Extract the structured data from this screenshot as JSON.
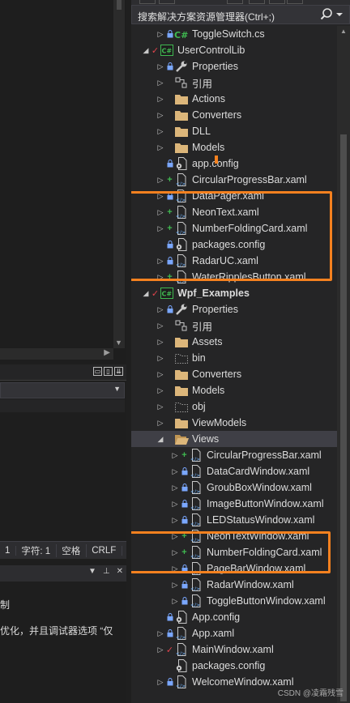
{
  "search": {
    "placeholder": "搜索解决方案资源管理器(Ctrl+;)"
  },
  "status_bar": {
    "line_col": "1",
    "char": "字符: 1",
    "spaces": "空格",
    "eol": "CRLF"
  },
  "output_text": {
    "line1": "制",
    "line2": "优化，并且调试器选项 “仅"
  },
  "tree": [
    {
      "label": "ToggleSwitch.cs",
      "depth": 1,
      "exp": "closed",
      "status": "lock",
      "icon": "csharp-file-icon"
    },
    {
      "label": "UserControlLib",
      "depth": 0,
      "exp": "open",
      "status": "check",
      "icon": "csharp-project-icon"
    },
    {
      "label": "Properties",
      "depth": 1,
      "exp": "closed",
      "status": "lock",
      "icon": "wrench-icon"
    },
    {
      "label": "引用",
      "depth": 1,
      "exp": "closed",
      "status": "",
      "icon": "references-icon"
    },
    {
      "label": "Actions",
      "depth": 1,
      "exp": "closed",
      "status": "",
      "icon": "folder-icon"
    },
    {
      "label": "Converters",
      "depth": 1,
      "exp": "closed",
      "status": "",
      "icon": "folder-icon"
    },
    {
      "label": "DLL",
      "depth": 1,
      "exp": "closed",
      "status": "",
      "icon": "folder-icon"
    },
    {
      "label": "Models",
      "depth": 1,
      "exp": "closed",
      "status": "",
      "icon": "folder-icon"
    },
    {
      "label": "app.config",
      "depth": 1,
      "exp": "none",
      "status": "lock",
      "icon": "config-file-icon"
    },
    {
      "label": "CircularProgressBar.xaml",
      "depth": 1,
      "exp": "closed",
      "status": "plus",
      "icon": "xaml-file-icon"
    },
    {
      "label": "DataPager.xaml",
      "depth": 1,
      "exp": "closed",
      "status": "lock",
      "icon": "xaml-file-icon"
    },
    {
      "label": "NeonText.xaml",
      "depth": 1,
      "exp": "closed",
      "status": "plus",
      "icon": "xaml-file-icon"
    },
    {
      "label": "NumberFoldingCard.xaml",
      "depth": 1,
      "exp": "closed",
      "status": "plus",
      "icon": "xaml-file-icon"
    },
    {
      "label": "packages.config",
      "depth": 1,
      "exp": "none",
      "status": "lock",
      "icon": "config-file-icon"
    },
    {
      "label": "RadarUC.xaml",
      "depth": 1,
      "exp": "closed",
      "status": "lock",
      "icon": "xaml-file-icon"
    },
    {
      "label": "WaterRipplesButton.xaml",
      "depth": 1,
      "exp": "closed",
      "status": "plus",
      "icon": "xaml-file-icon"
    },
    {
      "label": "Wpf_Examples",
      "depth": 0,
      "exp": "open",
      "status": "check",
      "icon": "csharp-project-icon",
      "bold": true
    },
    {
      "label": "Properties",
      "depth": 1,
      "exp": "closed",
      "status": "lock",
      "icon": "wrench-icon"
    },
    {
      "label": "引用",
      "depth": 1,
      "exp": "closed",
      "status": "",
      "icon": "references-icon"
    },
    {
      "label": "Assets",
      "depth": 1,
      "exp": "closed",
      "status": "",
      "icon": "folder-icon"
    },
    {
      "label": "bin",
      "depth": 1,
      "exp": "closed",
      "status": "",
      "icon": "dotted-folder-icon"
    },
    {
      "label": "Converters",
      "depth": 1,
      "exp": "closed",
      "status": "",
      "icon": "folder-icon"
    },
    {
      "label": "Models",
      "depth": 1,
      "exp": "closed",
      "status": "",
      "icon": "folder-icon"
    },
    {
      "label": "obj",
      "depth": 1,
      "exp": "closed",
      "status": "",
      "icon": "dotted-folder-icon"
    },
    {
      "label": "ViewModels",
      "depth": 1,
      "exp": "closed",
      "status": "",
      "icon": "folder-icon"
    },
    {
      "label": "Views",
      "depth": 1,
      "exp": "open",
      "status": "",
      "icon": "open-folder-icon",
      "selected": true
    },
    {
      "label": "CircularProgressBar.xaml",
      "depth": 2,
      "exp": "closed",
      "status": "plus",
      "icon": "xaml-file-icon"
    },
    {
      "label": "DataCardWindow.xaml",
      "depth": 2,
      "exp": "closed",
      "status": "lock",
      "icon": "xaml-file-icon"
    },
    {
      "label": "GroubBoxWindow.xaml",
      "depth": 2,
      "exp": "closed",
      "status": "lock",
      "icon": "xaml-file-icon"
    },
    {
      "label": "ImageButtonWindow.xaml",
      "depth": 2,
      "exp": "closed",
      "status": "lock",
      "icon": "xaml-file-icon"
    },
    {
      "label": "LEDStatusWindow.xaml",
      "depth": 2,
      "exp": "closed",
      "status": "lock",
      "icon": "xaml-file-icon"
    },
    {
      "label": "NeonTextWindow.xaml",
      "depth": 2,
      "exp": "closed",
      "status": "plus",
      "icon": "xaml-file-icon"
    },
    {
      "label": "NumberFoldingCard.xaml",
      "depth": 2,
      "exp": "closed",
      "status": "plus",
      "icon": "xaml-file-icon"
    },
    {
      "label": "PageBarWindow.xaml",
      "depth": 2,
      "exp": "closed",
      "status": "lock",
      "icon": "xaml-file-icon"
    },
    {
      "label": "RadarWindow.xaml",
      "depth": 2,
      "exp": "closed",
      "status": "lock",
      "icon": "xaml-file-icon"
    },
    {
      "label": "ToggleButtonWindow.xaml",
      "depth": 2,
      "exp": "closed",
      "status": "lock",
      "icon": "xaml-file-icon"
    },
    {
      "label": "App.config",
      "depth": 1,
      "exp": "none",
      "status": "lock",
      "icon": "config-file-icon"
    },
    {
      "label": "App.xaml",
      "depth": 1,
      "exp": "closed",
      "status": "lock",
      "icon": "xaml-file-icon"
    },
    {
      "label": "MainWindow.xaml",
      "depth": 1,
      "exp": "closed",
      "status": "check",
      "icon": "xaml-file-icon"
    },
    {
      "label": "packages.config",
      "depth": 1,
      "exp": "none",
      "status": "",
      "icon": "config-file-icon"
    },
    {
      "label": "WelcomeWindow.xaml",
      "depth": 1,
      "exp": "closed",
      "status": "lock",
      "icon": "xaml-file-icon"
    }
  ],
  "highlights": [
    {
      "label": "user-control-lib-highlight"
    },
    {
      "label": "views-highlight"
    }
  ],
  "watermark": "CSDN @凌霜残雪",
  "colors": {
    "highlight": "#f5811f",
    "selection": "#3f3f46",
    "added": "#3fb950",
    "checked": "#e0434c",
    "locked": "#7aa7ff"
  }
}
